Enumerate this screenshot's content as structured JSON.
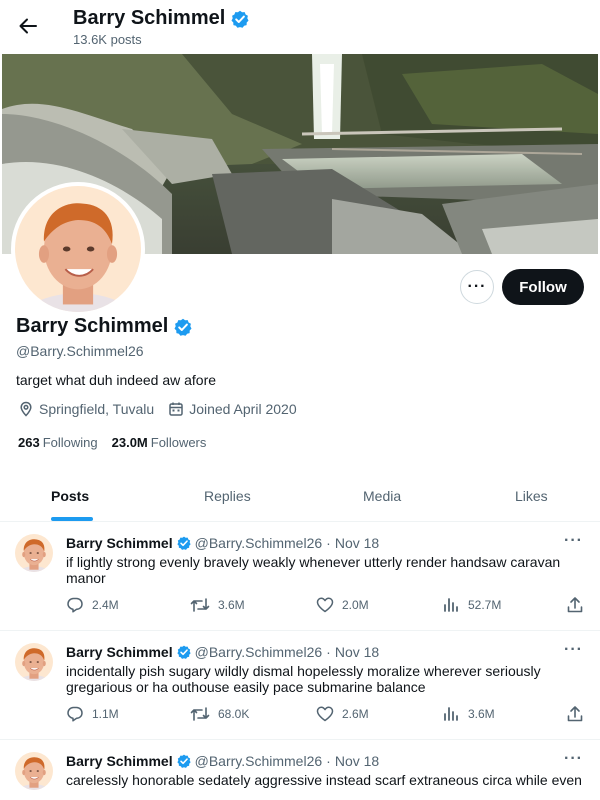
{
  "header": {
    "name": "Barry Schimmel",
    "posts_count": "13.6K posts"
  },
  "profile": {
    "name": "Barry Schimmel",
    "handle": "@Barry.Schimmel26",
    "bio": "target what duh indeed aw afore",
    "location": "Springfield, Tuvalu",
    "joined": "Joined April 2020",
    "following_count": "263",
    "following_label": "Following",
    "followers_count": "23.0M",
    "followers_label": "Followers",
    "follow_label": "Follow",
    "more_label": "···"
  },
  "tabs": [
    {
      "label": "Posts",
      "active": true
    },
    {
      "label": "Replies",
      "active": false
    },
    {
      "label": "Media",
      "active": false
    },
    {
      "label": "Likes",
      "active": false
    }
  ],
  "posts": [
    {
      "name": "Barry Schimmel",
      "handle": "@Barry.Schimmel26",
      "dot": "·",
      "date": "Nov 18",
      "text": "if lightly strong evenly bravely weakly whenever utterly render handsaw caravan manor",
      "replies": "2.4M",
      "reposts": "3.6M",
      "likes": "2.0M",
      "views": "52.7M",
      "more": "···"
    },
    {
      "name": "Barry Schimmel",
      "handle": "@Barry.Schimmel26",
      "dot": "·",
      "date": "Nov 18",
      "text": "incidentally pish sugary wildly dismal hopelessly moralize wherever seriously gregarious or ha outhouse easily pace submarine balance",
      "replies": "1.1M",
      "reposts": "68.0K",
      "likes": "2.6M",
      "views": "3.6M",
      "more": "···"
    },
    {
      "name": "Barry Schimmel",
      "handle": "@Barry.Schimmel26",
      "dot": "·",
      "date": "Nov 18",
      "text": "carelessly honorable sedately aggressive instead scarf extraneous circa while even",
      "more": "···"
    }
  ],
  "colors": {
    "accent": "#1d9bf0",
    "text": "#0f1419",
    "muted": "#536471",
    "follow_bg": "#0f1419",
    "verified": "#1d9bf0"
  },
  "icons": [
    "back-arrow-icon",
    "verified-badge-icon",
    "location-pin-icon",
    "calendar-icon",
    "reply-icon",
    "repost-icon",
    "like-icon",
    "views-icon",
    "share-icon",
    "more-icon"
  ]
}
